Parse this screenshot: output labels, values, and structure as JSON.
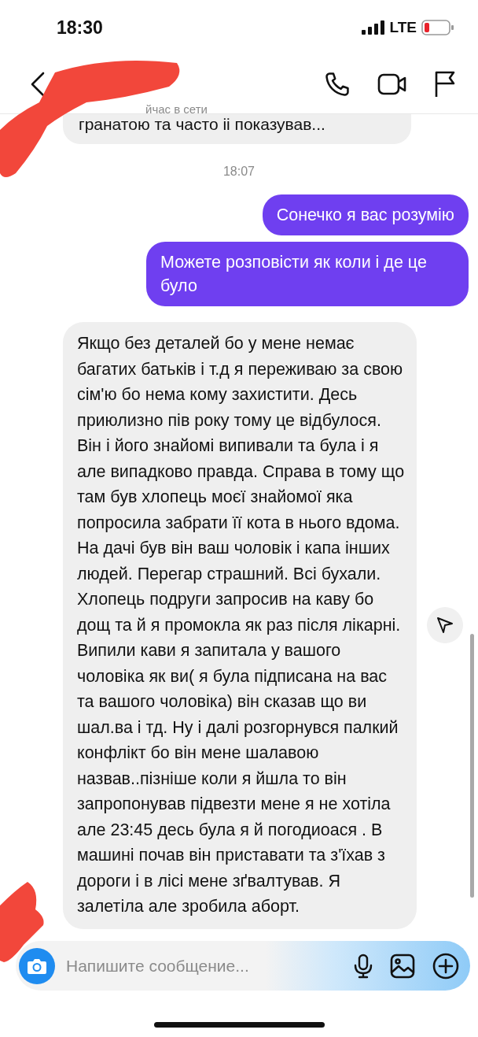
{
  "status_bar": {
    "time": "18:30",
    "network": "LTE"
  },
  "header": {
    "status": "йчас в сети"
  },
  "messages": [
    {
      "kind": "partial",
      "text": "гранатою та часто іі показував..."
    },
    {
      "kind": "timestamp",
      "text": "18:07"
    },
    {
      "kind": "outgoing",
      "text": "Сонечко я вас розумію"
    },
    {
      "kind": "outgoing",
      "text": "Можете розповісти як коли і де це було"
    },
    {
      "kind": "incoming",
      "text": "Якщо без деталей бо у мене немає багатих батьків і т.д я переживаю за свою сім'ю бо нема кому захистити. Десь приюлизно пів року тому це відбулося. Він і його знайомі випивали та була і я але випадково правда. Справа в тому що там був хлопець моєї знайомої яка попросила забрати її кота в нього вдома. На дачі був він ваш чоловік і капа інших людей. Перегар страшний. Всі бухали. Хлопець подруги запросив на каву бо дощ та й я промокла як раз після лікарні. Випили кави я запитала у вашого чоловіка як ви( я була підписана на вас та вашого чоловіка) він сказав що ви шал.ва і тд. Ну і далі розгорнувся палкий конфлікт бо він мене шалавою назвав..пізніше коли я йшла то він запропонував підвезти мене я не хотіла але 23:45 десь була я й погодиоася . В машині почав він приставати та з'їхав з дороги і в лісі мене зґвалтував. Я залетіла але зробила аборт."
    }
  ],
  "composer": {
    "placeholder": "Напишите сообщение..."
  }
}
